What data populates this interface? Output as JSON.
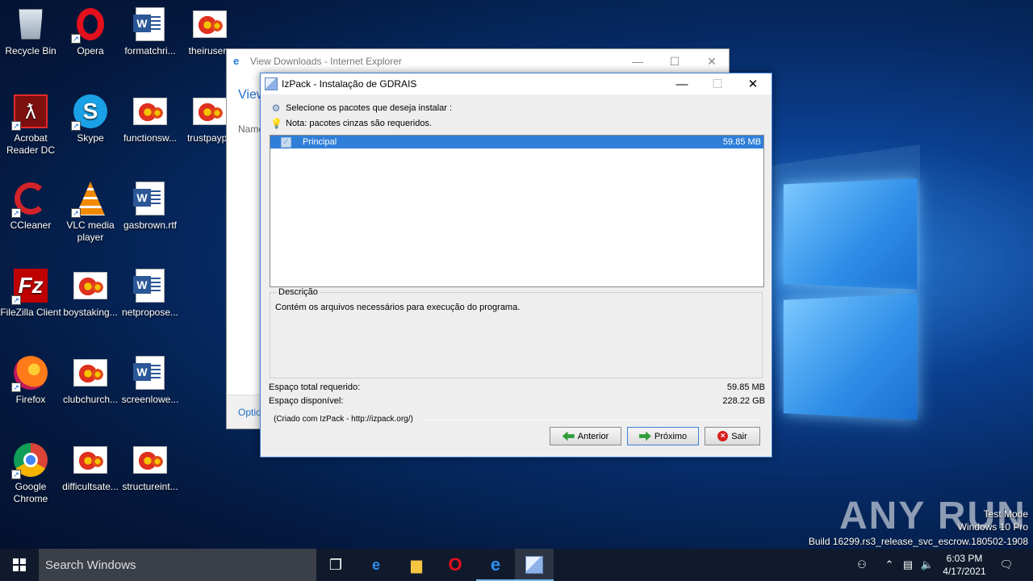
{
  "desktop": {
    "icons": [
      {
        "label": "Recycle Bin",
        "icon": "recycle-bin-icon"
      },
      {
        "label": "Opera",
        "icon": "opera-icon"
      },
      {
        "label": "formatchri...",
        "icon": "word-doc-icon"
      },
      {
        "label": "theirusers",
        "icon": "image-file-icon"
      },
      {
        "label": "Acrobat Reader DC",
        "icon": "acrobat-icon"
      },
      {
        "label": "Skype",
        "icon": "skype-icon"
      },
      {
        "label": "functionsw...",
        "icon": "image-file-icon"
      },
      {
        "label": "trustpaypa",
        "icon": "image-file-icon"
      },
      {
        "label": "CCleaner",
        "icon": "ccleaner-icon"
      },
      {
        "label": "VLC media player",
        "icon": "vlc-icon"
      },
      {
        "label": "gasbrown.rtf",
        "icon": "word-doc-icon"
      },
      {
        "label": "FileZilla Client",
        "icon": "filezilla-icon"
      },
      {
        "label": "boystaking...",
        "icon": "image-file-icon"
      },
      {
        "label": "netpropose...",
        "icon": "word-doc-icon"
      },
      {
        "label": "Firefox",
        "icon": "firefox-icon"
      },
      {
        "label": "clubchurch...",
        "icon": "image-file-icon"
      },
      {
        "label": "screenlowe...",
        "icon": "word-doc-icon"
      },
      {
        "label": "Google Chrome",
        "icon": "chrome-icon"
      },
      {
        "label": "difficultsate...",
        "icon": "image-file-icon"
      },
      {
        "label": "structureint...",
        "icon": "image-file-icon"
      }
    ]
  },
  "ie_window": {
    "title": "View Downloads - Internet Explorer",
    "heading": "View",
    "name_col": "Name",
    "options": "Optio"
  },
  "installer": {
    "title": "IzPack - Instalação de GDRAIS",
    "select_label": "Selecione os pacotes que deseja instalar :",
    "note_label": "Nota: pacotes cinzas são requeridos.",
    "packages": [
      {
        "name": "Principal",
        "size": "59.85 MB",
        "checked": true,
        "selected": true
      }
    ],
    "description_legend": "Descrição",
    "description_text": "Contém os arquivos necessários para execução do programa.",
    "required_label": "Espaço total requerido:",
    "required_value": "59.85 MB",
    "available_label": "Espaço disponível:",
    "available_value": "228.22 GB",
    "credit": "(Criado com IzPack - http://izpack.org/)",
    "back_label": "Anterior",
    "next_label": "Próximo",
    "quit_label": "Sair"
  },
  "watermark": {
    "brand": "ANY RUN",
    "line1": "Test Mode",
    "line2": "Windows 10 Pro",
    "line3": "Build 16299.rs3_release_svc_escrow.180502-1908"
  },
  "taskbar": {
    "search_placeholder": "Search Windows",
    "time": "6:03 PM",
    "date": "4/17/2021",
    "accent": "#76b9ed"
  }
}
